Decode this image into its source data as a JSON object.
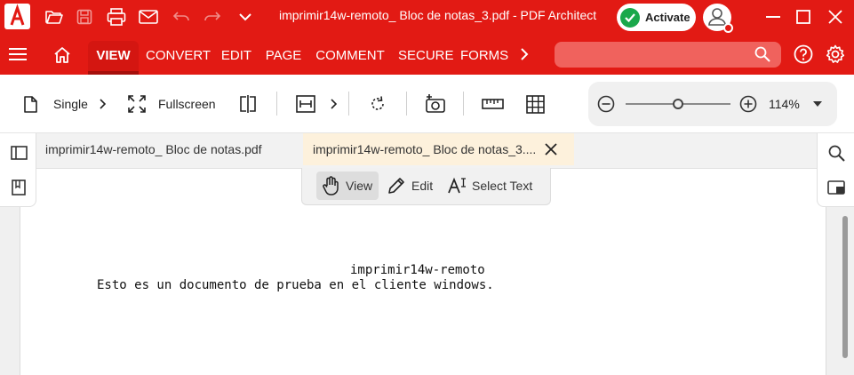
{
  "app": {
    "title": "imprimir14w-remoto_ Bloc de notas_3.pdf   -   PDF Architect",
    "activate_label": "Activate"
  },
  "ribbon": {
    "tabs": [
      {
        "label": "VIEW",
        "active": true
      },
      {
        "label": "CONVERT",
        "active": false
      },
      {
        "label": "EDIT",
        "active": false
      },
      {
        "label": "PAGE",
        "active": false
      },
      {
        "label": "COMMENT",
        "active": false
      },
      {
        "label": "SECURE",
        "active": false
      },
      {
        "label": "FORMS",
        "active": false
      }
    ],
    "search_placeholder": ""
  },
  "toolbar": {
    "single_label": "Single",
    "fullscreen_label": "Fullscreen",
    "zoom": {
      "value_label": "114%",
      "slider_fraction": 0.5
    }
  },
  "doc_tabs": [
    {
      "label": "imprimir14w-remoto_ Bloc de notas.pdf",
      "active": false
    },
    {
      "label": "imprimir14w-remoto_ Bloc de notas_3....",
      "active": true
    }
  ],
  "modes": {
    "view_label": "View",
    "edit_label": "Edit",
    "select_label": "Select Text",
    "active": "View"
  },
  "document": {
    "line1": "imprimir14w-remoto",
    "line2": "Esto es un documento de prueba en el cliente windows."
  },
  "colors": {
    "brand_red": "#e21a14",
    "active_tab": "#d41611",
    "activate_check": "#19a84a",
    "doc_tab_active": "#fdf1dc"
  }
}
